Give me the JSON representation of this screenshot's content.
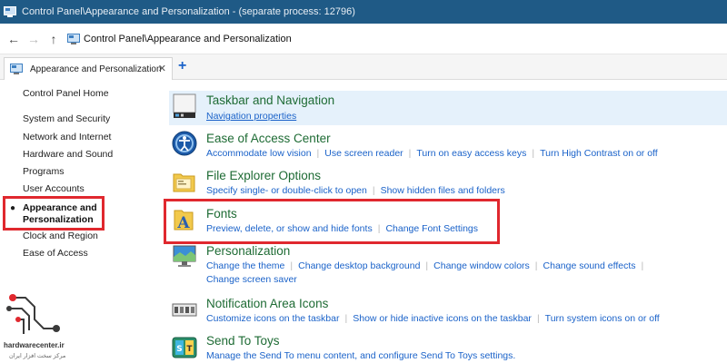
{
  "window": {
    "title": "Control Panel\\Appearance and Personalization - (separate process: 12796)"
  },
  "address": {
    "path": "Control Panel\\Appearance and Personalization"
  },
  "tabs": [
    {
      "label": "Appearance and Personalization"
    }
  ],
  "sidebar": {
    "home": "Control Panel Home",
    "items": [
      {
        "label": "System and Security"
      },
      {
        "label": "Network and Internet"
      },
      {
        "label": "Hardware and Sound"
      },
      {
        "label": "Programs"
      },
      {
        "label": "User Accounts"
      },
      {
        "label": "Appearance and Personalization",
        "line1": "Appearance and",
        "line2": "Personalization",
        "selected": true
      },
      {
        "label": "Clock and Region"
      },
      {
        "label": "Ease of Access"
      }
    ]
  },
  "categories": [
    {
      "title": "Taskbar and Navigation",
      "icon": "taskbar-icon",
      "links": [
        "Navigation properties"
      ]
    },
    {
      "title": "Ease of Access Center",
      "icon": "ease-of-access-icon",
      "links": [
        "Accommodate low vision",
        "Use screen reader",
        "Turn on easy access keys",
        "Turn High Contrast on or off"
      ]
    },
    {
      "title": "File Explorer Options",
      "icon": "folder-options-icon",
      "links": [
        "Specify single- or double-click to open",
        "Show hidden files and folders"
      ]
    },
    {
      "title": "Fonts",
      "icon": "fonts-folder-icon",
      "links": [
        "Preview, delete, or show and hide fonts",
        "Change Font Settings"
      ]
    },
    {
      "title": "Personalization",
      "icon": "personalization-icon",
      "links": [
        "Change the theme",
        "Change desktop background",
        "Change window colors",
        "Change sound effects",
        "Change screen saver"
      ]
    },
    {
      "title": "Notification Area Icons",
      "icon": "notification-area-icon",
      "links": [
        "Customize icons on the taskbar",
        "Show or hide inactive icons on the taskbar",
        "Turn system icons on or off"
      ]
    },
    {
      "title": "Send To Toys",
      "icon": "send-to-toys-icon",
      "links": [
        "Manage the Send To menu content, and configure Send To Toys settings."
      ]
    }
  ],
  "watermark": {
    "brand": "hardwarecenter.ir",
    "tagline": "مرکز سخت افزار ایران"
  },
  "colors": {
    "titlebar": "#1f5a86",
    "link": "#1a62c9",
    "category_title": "#1e6b34",
    "highlight": "#e5f1fb",
    "callout": "#e0282e"
  }
}
